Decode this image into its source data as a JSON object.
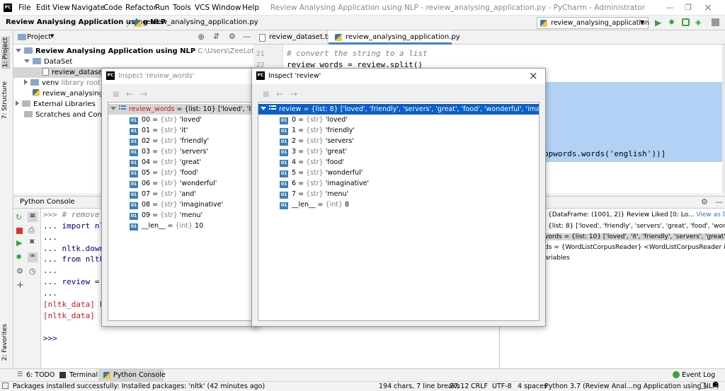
{
  "menu": {
    "file": "File",
    "edit": "Edit",
    "view": "View",
    "navigate": "Navigate",
    "code": "Code",
    "refactor": "Refactor",
    "run": "Run",
    "tools": "Tools",
    "vcs": "VCS",
    "window": "Window",
    "help": "Help"
  },
  "window_title": "Review Analysing Application using NLP - review_analysing_application.py - PyCharm - Administrator",
  "navbar": {
    "project": "Review Analysing Application using NLP",
    "sep": "〉",
    "file": "review_analysing_application.py",
    "run_config": "review_analysing_application"
  },
  "left_tabs": {
    "project": "1: Project",
    "structure": "7: Structure",
    "favorites": "2: Favorites"
  },
  "project_panel": {
    "title": "Project",
    "rows": [
      {
        "label": "Review Analysing Application using NLP",
        "extra": "C:\\Users\\ZeeLot\\PycharmProjects\\"
      },
      {
        "label": "DataSet",
        "extra": ""
      },
      {
        "label": "review_dataset.tsv",
        "extra": ""
      },
      {
        "label": "venv",
        "extra": "library root"
      },
      {
        "label": "review_analysing_ap",
        "extra": ""
      },
      {
        "label": "External Libraries",
        "extra": ""
      },
      {
        "label": "Scratches and Consoles",
        "extra": ""
      }
    ]
  },
  "editor": {
    "tabs": [
      "review_dataset.tsv",
      "review_analysing_application.py"
    ],
    "line_numbers": [
      "21",
      "22"
    ],
    "comment": "# convert the string to a list",
    "code": "review_words = review.split()",
    "code_tail": "opwords.words('english'))]"
  },
  "console": {
    "title": "Python Console",
    "lines": [
      ">>> # remove n",
      "... import nlt",
      "...",
      "... nltk.downl",
      "... from nltk.",
      "...",
      "... review = [",
      "...",
      "[nltk_data] Er",
      "[nltk_data]",
      ">>>"
    ]
  },
  "variables": {
    "rows": [
      {
        "text": "{DataFrame: (1001, 2)} Review Liked [0: Lo...",
        "link": "View as DataFrame"
      },
      {
        "text": "{list: 8} ['loved', 'friendly', 'servers', 'great', 'food', 'wonderful', 'im",
        "link": ""
      },
      {
        "text": "vords = {list: 10} ['loved', 'it', 'friendly', 'servers', 'great', 'food', 'w",
        "link": ""
      },
      {
        "text": "ds = {WordListCorpusReader} <WordListCorpusReader in 'C:\\\\Us",
        "link": ""
      },
      {
        "text": "ariables",
        "link": ""
      }
    ]
  },
  "inspect_review_words": {
    "title": "Inspect 'review_words'",
    "root_name": "review_words",
    "root_value": " = {list: 10} ['loved', 'it', 'friendl",
    "items": [
      {
        "idx": "00",
        "type": "{str}",
        "val": "'loved'"
      },
      {
        "idx": "01",
        "type": "{str}",
        "val": "'it'"
      },
      {
        "idx": "02",
        "type": "{str}",
        "val": "'friendly'"
      },
      {
        "idx": "03",
        "type": "{str}",
        "val": "'servers'"
      },
      {
        "idx": "04",
        "type": "{str}",
        "val": "'great'"
      },
      {
        "idx": "05",
        "type": "{str}",
        "val": "'food'"
      },
      {
        "idx": "06",
        "type": "{str}",
        "val": "'wonderful'"
      },
      {
        "idx": "07",
        "type": "{str}",
        "val": "'and'"
      },
      {
        "idx": "08",
        "type": "{str}",
        "val": "'imaginative'"
      },
      {
        "idx": "09",
        "type": "{str}",
        "val": "'menu'"
      },
      {
        "idx": "__len__",
        "type": "{int}",
        "val": "10"
      }
    ]
  },
  "inspect_review": {
    "title": "Inspect 'review'",
    "root": "review = {list: 8} ['loved', 'friendly', 'servers', 'great', 'food', 'wonderful', 'imaginative', 'menu']",
    "items": [
      {
        "idx": "0",
        "type": "{str}",
        "val": "'loved'"
      },
      {
        "idx": "1",
        "type": "{str}",
        "val": "'friendly'"
      },
      {
        "idx": "2",
        "type": "{str}",
        "val": "'servers'"
      },
      {
        "idx": "3",
        "type": "{str}",
        "val": "'great'"
      },
      {
        "idx": "4",
        "type": "{str}",
        "val": "'food'"
      },
      {
        "idx": "5",
        "type": "{str}",
        "val": "'wonderful'"
      },
      {
        "idx": "6",
        "type": "{str}",
        "val": "'imaginative'"
      },
      {
        "idx": "7",
        "type": "{str}",
        "val": "'menu'"
      },
      {
        "idx": "__len__",
        "type": "{int}",
        "val": "8"
      }
    ]
  },
  "bottom_tabs": {
    "todo": "6: TODO",
    "terminal": "Terminal",
    "python_console": "Python Console",
    "event_log": "Event Log"
  },
  "status": {
    "message": "Packages installed successfully: Installed packages: 'nltk' (42 minutes ago)",
    "chars": "194 chars, 7 line breaks",
    "pos": "27:12",
    "crlf": "CRLF",
    "enc": "UTF-8",
    "indent": "4 spaces",
    "interp": "Python 3.7 (Review Anal...ng Application using NLP)"
  },
  "colors": {
    "accent": "#0a60c8",
    "selection": "#b3d1f5",
    "red_text": "#c41a16",
    "comment": "#808080"
  }
}
